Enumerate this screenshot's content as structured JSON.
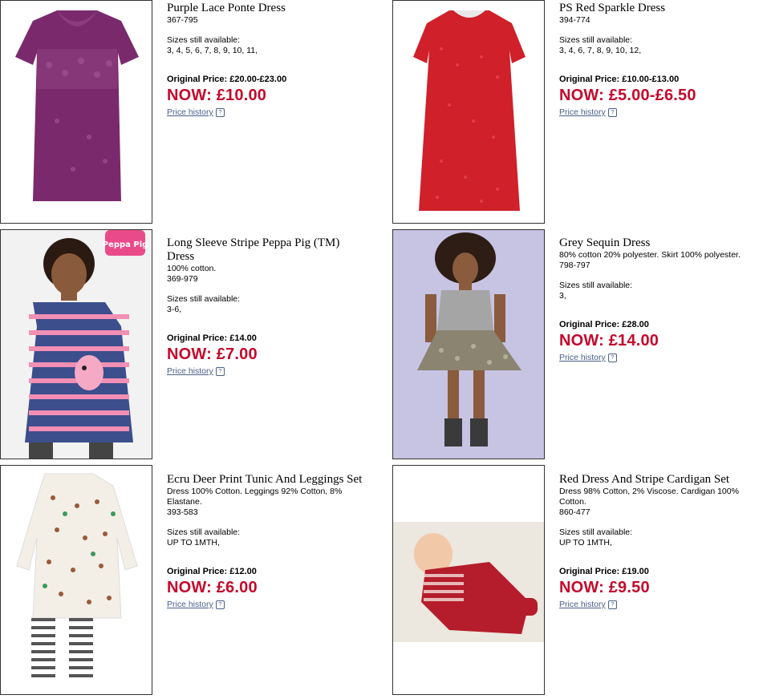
{
  "products": [
    {
      "title": "Purple Lace Ponte Dress",
      "desc": "",
      "code": "367-795",
      "sizes_label": "Sizes still available:",
      "sizes": "3, 4, 5, 6, 7, 8, 9, 10, 11,",
      "original": "Original Price: £20.00-£23.00",
      "now": "NOW: £10.00",
      "history": "Price history",
      "color": "#7a2a6c"
    },
    {
      "title": "PS Red Sparkle Dress",
      "desc": "",
      "code": "394-774",
      "sizes_label": "Sizes still available:",
      "sizes": "3, 4, 6, 7, 8, 9, 10, 12,",
      "original": "Original Price: £10.00-£13.00",
      "now": "NOW: £5.00-£6.50",
      "history": "Price history",
      "color": "#d0202a"
    },
    {
      "title": "Long Sleeve Stripe Peppa Pig (TM) Dress",
      "desc": "100% cotton.",
      "code": "369-979",
      "sizes_label": "Sizes still available:",
      "sizes": "3-6,",
      "original": "Original Price: £14.00",
      "now": "NOW: £7.00",
      "history": "Price history",
      "color": "#3c4e8c"
    },
    {
      "title": "Grey Sequin Dress",
      "desc": "80% cotton 20% polyester. Skirt 100% polyester.",
      "code": "798-797",
      "sizes_label": "Sizes still available:",
      "sizes": "3,",
      "original": "Original Price: £28.00",
      "now": "NOW: £14.00",
      "history": "Price history",
      "color": "#9a9a9a"
    },
    {
      "title": "Ecru Deer Print Tunic And Leggings Set",
      "desc": "Dress 100% Cotton. Leggings 92% Cotton, 8% Elastane.",
      "code": "393-583",
      "sizes_label": "Sizes still available:",
      "sizes": "UP TO 1MTH,",
      "original": "Original Price: £12.00",
      "now": "NOW: £6.00",
      "history": "Price history",
      "color": "#f3efe6"
    },
    {
      "title": "Red Dress And Stripe Cardigan Set",
      "desc": "Dress 98% Cotton, 2% Viscose. Cardigan 100% Cotton.",
      "code": "860-477",
      "sizes_label": "Sizes still available:",
      "sizes": "UP TO 1MTH,",
      "original": "Original Price: £19.00",
      "now": "NOW: £9.50",
      "history": "Price history",
      "color": "#b51d2c"
    }
  ],
  "logo_text": "Peppa Pig",
  "help_glyph": "?"
}
